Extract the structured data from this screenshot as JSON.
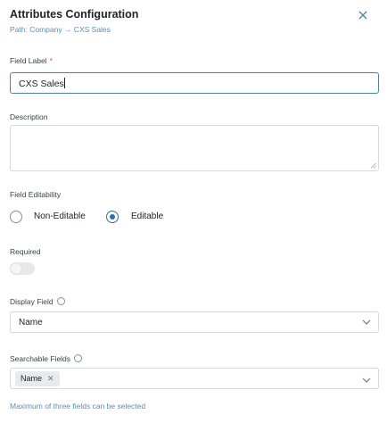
{
  "header": {
    "title": "Attributes Configuration",
    "path": "Path: Company → CXS Sales"
  },
  "field_label": {
    "label": "Field Label",
    "required_mark": "*",
    "value": "CXS Sales"
  },
  "description": {
    "label": "Description",
    "value": ""
  },
  "editability": {
    "label": "Field Editability",
    "options": [
      "Non-Editable",
      "Editable"
    ],
    "selected": "Editable"
  },
  "required": {
    "label": "Required",
    "enabled": false
  },
  "display_field": {
    "label": "Display Field",
    "value": "Name"
  },
  "searchable_fields": {
    "label": "Searchable Fields",
    "chips": [
      "Name"
    ],
    "helper": "Maximum of three fields can be selected"
  },
  "icons": {
    "close": "close-icon",
    "info": "info-icon",
    "chevron": "chevron-down-icon",
    "remove": "remove-chip-icon"
  },
  "colors": {
    "accent": "#2f6fa8",
    "link_text": "#5b8fb3",
    "required": "#e0454d"
  }
}
